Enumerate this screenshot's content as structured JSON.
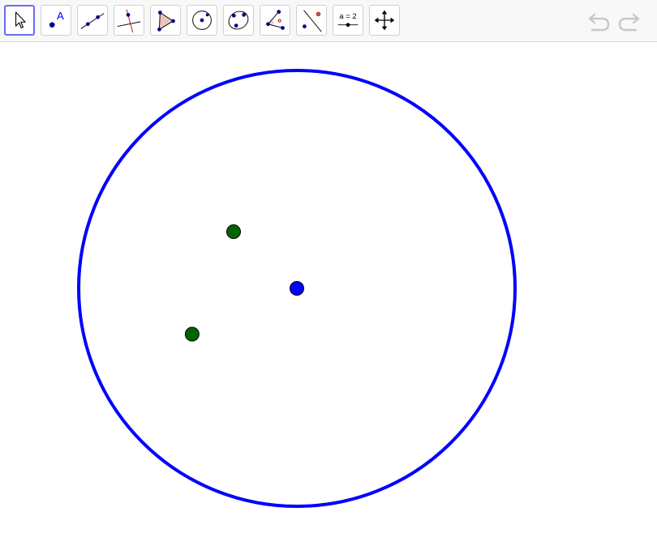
{
  "toolbar": {
    "tools": [
      {
        "icon": "move-arrow-icon",
        "active": true
      },
      {
        "icon": "point-icon",
        "point_label": "A"
      },
      {
        "icon": "line-icon"
      },
      {
        "icon": "perpendicular-line-icon"
      },
      {
        "icon": "polygon-icon"
      },
      {
        "icon": "circle-center-point-icon"
      },
      {
        "icon": "ellipse-icon"
      },
      {
        "icon": "angle-icon"
      },
      {
        "icon": "reflect-about-line-icon"
      },
      {
        "icon": "slider-icon",
        "slider_label": "a = 2"
      },
      {
        "icon": "move-graphics-view-icon"
      }
    ],
    "undo_icon": "undo-icon",
    "redo_icon": "redo-icon"
  },
  "colors": {
    "toolbar_bg": "#f8f8f8",
    "active_tool_border": "#6b6bf0",
    "circle_stroke": "#0000ff",
    "center_point": "#0000ff",
    "green_point": "#006400",
    "icon_point": "#00008b",
    "icon_red": "#cc0000",
    "disabled": "#c8c8c8"
  },
  "construction": {
    "circle": {
      "cx": 0,
      "cy": 0,
      "r": 10
    },
    "center": {
      "x": 0,
      "y": 0
    },
    "points": [
      {
        "x": -2.9,
        "y": 2.6
      },
      {
        "x": -4.8,
        "y": -2.1
      }
    ]
  }
}
